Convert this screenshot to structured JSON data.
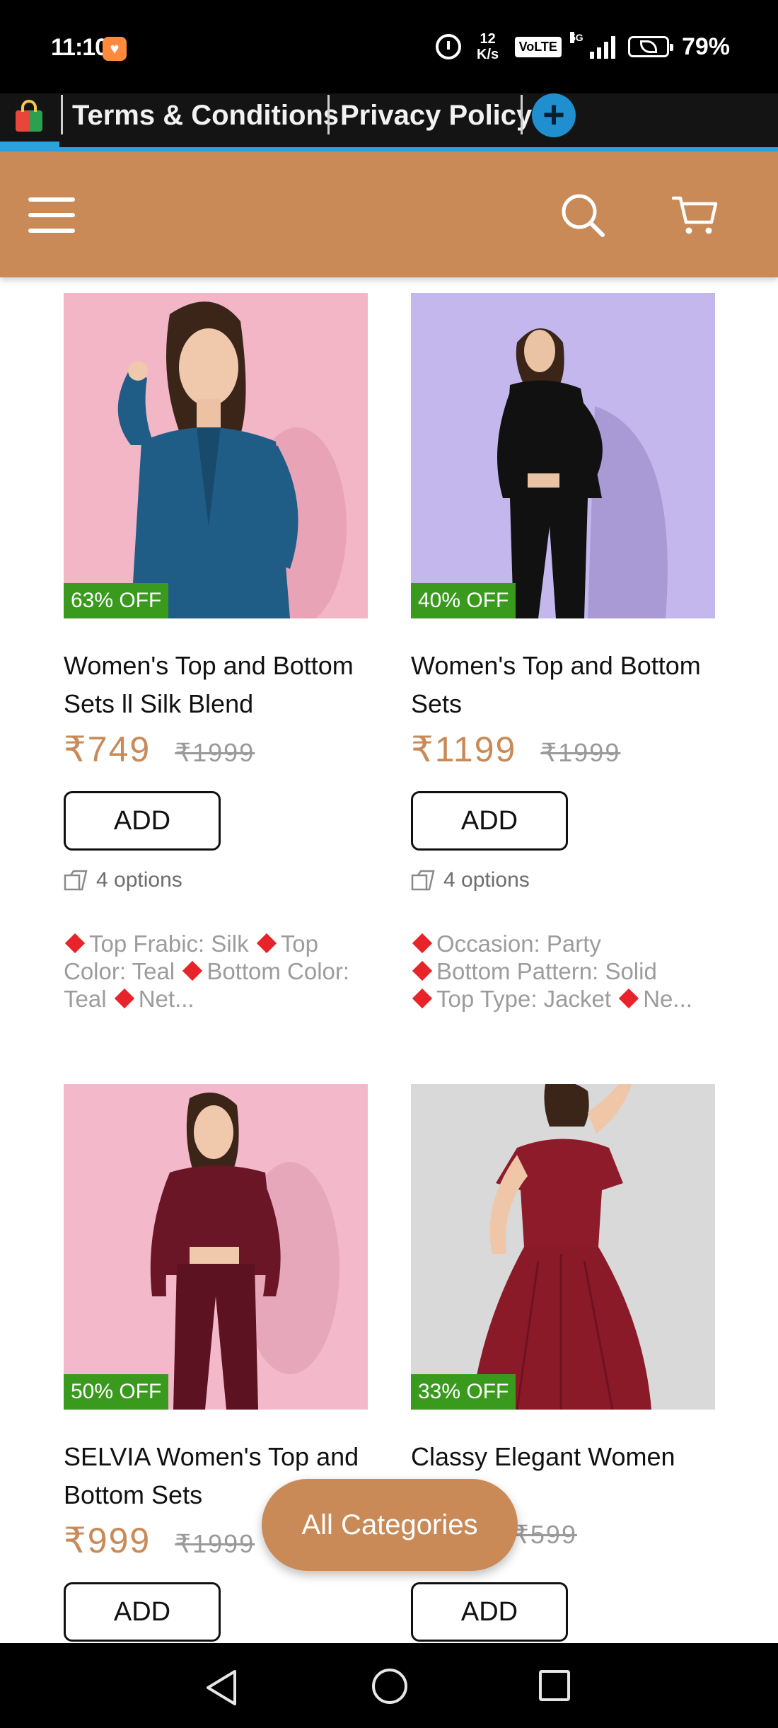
{
  "status_bar": {
    "time": "11:10",
    "net_speed": "12",
    "net_speed_unit": "K/s",
    "volte": "VoLTE",
    "network": "5G",
    "battery": "79%"
  },
  "tabs": {
    "terms": "Terms & Conditions",
    "privacy": "Privacy Policy",
    "add": "+"
  },
  "header": {
    "brand_color": "#c98a58"
  },
  "products": [
    {
      "discount": "63% OFF",
      "title": "Women's Top and Bottom Sets ll Silk Blend",
      "price": "₹749",
      "mrp": "₹1999",
      "add_label": "ADD",
      "options": "4 options",
      "attr_1": "Top Frabic: Silk",
      "attr_2": "Top Color: Teal",
      "attr_3": "Bottom Color: Teal",
      "attr_4": "Net..."
    },
    {
      "discount": "40% OFF",
      "title": "Women's Top and Bottom Sets",
      "price": "₹1199",
      "mrp": "₹1999",
      "add_label": "ADD",
      "options": "4 options",
      "attr_1": "Occasion: Party",
      "attr_2": "Bottom Pattern: Solid",
      "attr_3": "Top Type: Jacket",
      "attr_4": "Ne..."
    },
    {
      "discount": "50% OFF",
      "title": "SELVIA Women's Top and Bottom Sets",
      "price": "₹999",
      "mrp": "₹1999",
      "add_label": "ADD"
    },
    {
      "discount": "33% OFF",
      "title": "Classy Elegant Women",
      "price": "",
      "mrp": "₹599",
      "add_label": "ADD"
    }
  ],
  "floating": {
    "categories_label": "All Categories"
  }
}
